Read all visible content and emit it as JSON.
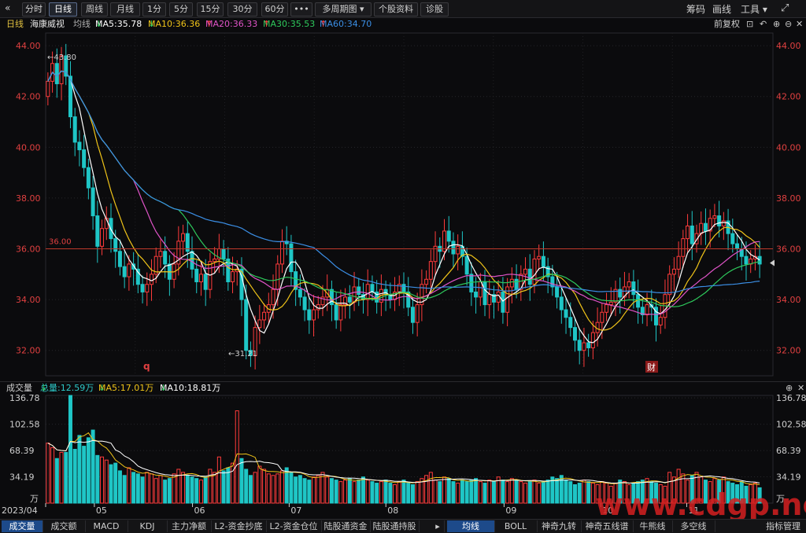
{
  "toolbar": {
    "collapse_icon": "double-chevron-left-icon",
    "periods": [
      "分时",
      "日线",
      "周线",
      "月线",
      "1分",
      "5分",
      "15分",
      "30分",
      "60分"
    ],
    "active_period": "日线",
    "more_label": "•••",
    "multi_period": "多周期图",
    "stock_info": "个股资料",
    "diagnose": "诊股",
    "right_items": [
      "筹码",
      "画线",
      "工具"
    ],
    "expand_icon": "expand-arrows-icon"
  },
  "info": {
    "period": "日线",
    "name": "海康威视",
    "ma_label": "均线",
    "ma5": "MA5:35.78",
    "ma10": "MA10:36.36",
    "ma20": "MA20:36.33",
    "ma30": "MA30:35.53",
    "ma60": "MA60:34.70",
    "adjust": "前复权",
    "ma5_color": "#ffffff",
    "ma10_color": "#f0c419",
    "ma20_color": "#e054c8",
    "ma30_color": "#2ec95c",
    "ma60_color": "#3b8fe6"
  },
  "volume_info": {
    "title": "成交量",
    "total": "总量:12.59万",
    "ma5": "MA5:17.01万",
    "ma10": "MA10:18.81万"
  },
  "bottom_tabs_left": [
    "成交量",
    "成交额",
    "MACD",
    "KDJ",
    "主力净额",
    "L2-资金抄底",
    "L2-资金仓位",
    "陆股通资金",
    "陆股通持股"
  ],
  "bottom_tabs_right": [
    "均线",
    "BOLL",
    "神奇九转",
    "神奇五线谱",
    "牛熊线",
    "多空线"
  ],
  "bottom_right_label": "指标管理",
  "watermark": "www.cdgp.net",
  "chart_data": [
    {
      "type": "candlestick",
      "y_ticks": [
        "44.00",
        "42.00",
        "40.00",
        "38.00",
        "36.00",
        "34.00",
        "32.00"
      ],
      "ylim": [
        31.0,
        44.5
      ],
      "x_ticks": [
        "2023/04",
        "05",
        "06",
        "07",
        "08",
        "09",
        "10",
        "11"
      ],
      "annotations": {
        "high": "43.80",
        "low": "31.21",
        "hline_label": "36.00",
        "hline": 36.0,
        "event_q": "q",
        "event_cai": "财"
      },
      "close": [
        42.6,
        43.3,
        42.5,
        43.6,
        42.8,
        41.2,
        40.2,
        39.9,
        39.2,
        38.4,
        37.3,
        36.1,
        36.8,
        37.2,
        36.4,
        35.9,
        35.3,
        34.9,
        35.4,
        35.2,
        34.6,
        34.3,
        34.6,
        35.0,
        35.7,
        35.9,
        35.4,
        34.8,
        35.4,
        36.3,
        36.6,
        35.9,
        35.2,
        34.7,
        35.0,
        34.4,
        35.5,
        35.6,
        36.0,
        35.6,
        34.7,
        35.1,
        35.2,
        34.0,
        32.0,
        31.8,
        32.9,
        33.2,
        33.5,
        33.8,
        34.4,
        35.4,
        36.3,
        36.2,
        35.1,
        34.4,
        34.1,
        33.6,
        33.2,
        33.6,
        33.8,
        34.1,
        34.4,
        33.8,
        33.2,
        33.8,
        34.1,
        33.9,
        34.5,
        34.2,
        34.0,
        34.6,
        34.3,
        33.9,
        34.4,
        34.2,
        34.0,
        34.3,
        34.6,
        34.3,
        33.7,
        33.1,
        33.8,
        34.6,
        34.8,
        35.5,
        36.1,
        35.9,
        36.7,
        36.3,
        35.8,
        36.1,
        35.7,
        35.0,
        34.3,
        34.1,
        34.7,
        33.8,
        34.2,
        33.9,
        34.3,
        33.5,
        34.5,
        34.8,
        34.4,
        35.0,
        35.2,
        34.6,
        35.6,
        35.7,
        35.3,
        34.9,
        34.5,
        34.1,
        33.6,
        33.3,
        32.9,
        32.4,
        32.0,
        32.3,
        32.1,
        32.7,
        33.1,
        33.5,
        33.8,
        33.9,
        34.4,
        34.1,
        34.5,
        34.7,
        34.2,
        33.7,
        33.4,
        33.8,
        33.7,
        33.0,
        33.3,
        34.2,
        35.0,
        35.2,
        35.7,
        36.4,
        36.9,
        36.2,
        36.6,
        37.0,
        36.7,
        37.2,
        37.3,
        36.9,
        37.1,
        36.6,
        36.2,
        36.0,
        35.7,
        35.4,
        35.6,
        35.7,
        35.4
      ]
    },
    {
      "type": "bar",
      "y_ticks": [
        "136.78",
        "102.58",
        "68.39",
        "34.19"
      ],
      "unit": "万",
      "ylim": [
        0,
        140
      ],
      "values": [
        78,
        72,
        58,
        66,
        66,
        140,
        70,
        88,
        74,
        85,
        95,
        62,
        60,
        56,
        50,
        52,
        42,
        36,
        46,
        40,
        38,
        34,
        40,
        38,
        32,
        36,
        30,
        32,
        38,
        44,
        40,
        36,
        34,
        32,
        30,
        34,
        44,
        40,
        60,
        42,
        46,
        52,
        120,
        58,
        44,
        36,
        40,
        48,
        44,
        38,
        36,
        38,
        42,
        46,
        40,
        34,
        36,
        32,
        30,
        34,
        36,
        40,
        34,
        32,
        30,
        28,
        30,
        32,
        28,
        30,
        34,
        30,
        28,
        26,
        28,
        30,
        26,
        24,
        28,
        30,
        26,
        24,
        28,
        32,
        36,
        40,
        30,
        28,
        34,
        32,
        28,
        26,
        30,
        28,
        30,
        32,
        28,
        26,
        30,
        28,
        34,
        30,
        28,
        32,
        30,
        28,
        26,
        28,
        30,
        26,
        28,
        30,
        34,
        32,
        36,
        30,
        28,
        24,
        26,
        30,
        28,
        26,
        24,
        28,
        26,
        22,
        26,
        30,
        28,
        24,
        26,
        28,
        30,
        32,
        28,
        26,
        24,
        22,
        40,
        34,
        44,
        38,
        30,
        36,
        40,
        34,
        30,
        28,
        32,
        30,
        34,
        28,
        26,
        24,
        28,
        22,
        24,
        26,
        20
      ]
    }
  ]
}
